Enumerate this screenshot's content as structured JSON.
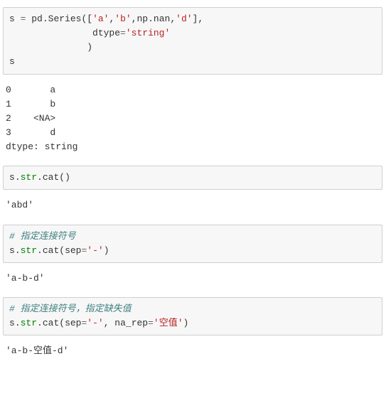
{
  "cell1": {
    "s": "s",
    "eq": " = ",
    "pd": "pd",
    "dot1": ".",
    "series": "Series",
    "open": "([",
    "a": "'a'",
    "c1": ",",
    "b": "'b'",
    "c2": ",",
    "np": "np",
    "dot2": ".",
    "nan": "nan",
    "c3": ",",
    "d": "'d'",
    "close1": "],",
    "indent2": "               ",
    "dtype_kw": "dtype",
    "eq2": "=",
    "string_val": "'string'",
    "indent3": "              ",
    "close2": ")",
    "s_echo": "s"
  },
  "out1": {
    "l1": "0       a",
    "l2": "1       b",
    "l3": "2    <NA>",
    "l4": "3       d",
    "l5": "dtype: string"
  },
  "cell2": {
    "s": "s",
    "dot1": ".",
    "str": "str",
    "dot2": ".",
    "cat": "cat",
    "open": "(",
    "close": ")"
  },
  "out2": {
    "v": "'abd'"
  },
  "cell3": {
    "comment": "# 指定连接符号",
    "s": "s",
    "dot1": ".",
    "str": "str",
    "dot2": ".",
    "cat": "cat",
    "open": "(",
    "sep_kw": "sep",
    "eq": "=",
    "sep_val": "'-'",
    "close": ")"
  },
  "out3": {
    "v": "'a-b-d'"
  },
  "cell4": {
    "comment": "# 指定连接符号，指定缺失值",
    "s": "s",
    "dot1": ".",
    "str": "str",
    "dot2": ".",
    "cat": "cat",
    "open": "(",
    "sep_kw": "sep",
    "eq1": "=",
    "sep_val": "'-'",
    "comma": ", ",
    "na_kw": "na_rep",
    "eq2": "=",
    "na_val": "'空值'",
    "close": ")"
  },
  "out4": {
    "v": "'a-b-空值-d'"
  }
}
